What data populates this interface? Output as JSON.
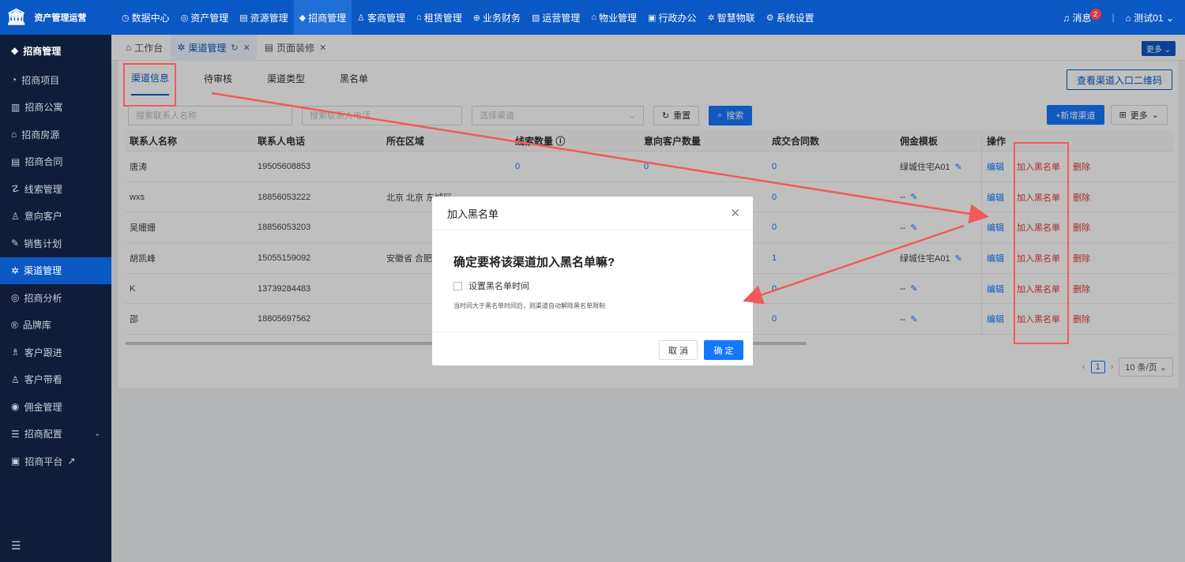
{
  "app": {
    "title": "资产管理运营"
  },
  "topnav": [
    {
      "icon": "dashboard-icon",
      "glyph": "◷",
      "label": "数据中心",
      "active": false
    },
    {
      "icon": "cube-icon",
      "glyph": "◎",
      "label": "资产管理",
      "active": false
    },
    {
      "icon": "resource-icon",
      "glyph": "▤",
      "label": "资源管理",
      "active": false
    },
    {
      "icon": "tag-icon",
      "glyph": "◆",
      "label": "招商管理",
      "active": true
    },
    {
      "icon": "customer-icon",
      "glyph": "♙",
      "label": "客商管理",
      "active": false
    },
    {
      "icon": "building-icon",
      "glyph": "⌂",
      "label": "租赁管理",
      "active": false
    },
    {
      "icon": "finance-icon",
      "glyph": "⊕",
      "label": "业务财务",
      "active": false
    },
    {
      "icon": "operation-icon",
      "glyph": "▧",
      "label": "运营管理",
      "active": false
    },
    {
      "icon": "property-icon",
      "glyph": "⌂",
      "label": "物业管理",
      "active": false
    },
    {
      "icon": "office-icon",
      "glyph": "▣",
      "label": "行政办公",
      "active": false
    },
    {
      "icon": "iot-icon",
      "glyph": "✲",
      "label": "智慧物联",
      "active": false
    },
    {
      "icon": "settings-icon",
      "glyph": "⚙",
      "label": "系统设置",
      "active": false
    }
  ],
  "topright": {
    "message_label": "消息",
    "message_count": "2",
    "user": "测试01"
  },
  "sidebar": {
    "header": "招商管理",
    "items": [
      {
        "label": "招商项目",
        "glyph": "◔",
        "active": false
      },
      {
        "label": "招商公寓",
        "glyph": "▥",
        "active": false
      },
      {
        "label": "招商房源",
        "glyph": "⌂",
        "active": false
      },
      {
        "label": "招商合同",
        "glyph": "▤",
        "active": false
      },
      {
        "label": "线索管理",
        "glyph": "☡",
        "active": false
      },
      {
        "label": "意向客户",
        "glyph": "♙",
        "active": false
      },
      {
        "label": "销售计划",
        "glyph": "✎",
        "active": false
      },
      {
        "label": "渠道管理",
        "glyph": "✲",
        "active": true
      },
      {
        "label": "招商分析",
        "glyph": "◎",
        "active": false
      },
      {
        "label": "品牌库",
        "glyph": "®",
        "active": false
      },
      {
        "label": "客户跟进",
        "glyph": "♗",
        "active": false
      },
      {
        "label": "客户带看",
        "glyph": "♙",
        "active": false
      },
      {
        "label": "佣金管理",
        "glyph": "◉",
        "active": false
      },
      {
        "label": "招商配置",
        "glyph": "☰",
        "active": false,
        "has_arrow": true
      },
      {
        "label": "招商平台",
        "glyph": "▣",
        "active": false,
        "external": true
      }
    ]
  },
  "pagetabs": [
    {
      "label": "工作台",
      "glyph": "⌂",
      "active": false,
      "closable": false
    },
    {
      "label": "渠道管理",
      "glyph": "✲",
      "active": true,
      "closable": true
    },
    {
      "label": "页面装修",
      "glyph": "▤",
      "active": false,
      "closable": true
    }
  ],
  "pagetabs_more": "更多",
  "subtabs": [
    {
      "label": "渠道信息",
      "active": true
    },
    {
      "label": "待审核",
      "active": false
    },
    {
      "label": "渠道类型",
      "active": false
    },
    {
      "label": "黑名单",
      "active": false
    }
  ],
  "qr_button": "查看渠道入口二维码",
  "filters": {
    "name_placeholder": "搜索联系人名称",
    "phone_placeholder": "搜索联系人电话",
    "channel_placeholder": "选择渠道",
    "reset": "重置",
    "search": "搜索",
    "add": "+新增渠道",
    "more": "更多"
  },
  "table": {
    "headers": [
      "联系人名称",
      "联系人电话",
      "所在区域",
      "线索数量",
      "意向客户数量",
      "成交合同数",
      "佣金模板",
      "操作"
    ],
    "rows": [
      {
        "name": "唐涛",
        "phone": "19505608853",
        "region": "",
        "leads": "0",
        "intent": "0",
        "contracts": "0",
        "template": "绿城住宅A01"
      },
      {
        "name": "wxs",
        "phone": "18856053222",
        "region": "北京 北京 东城区",
        "leads": "",
        "intent": "",
        "contracts": "0",
        "template": "--"
      },
      {
        "name": "吴姗姗",
        "phone": "18856053203",
        "region": "",
        "leads": "",
        "intent": "",
        "contracts": "0",
        "template": "--"
      },
      {
        "name": "胡凯峰",
        "phone": "15055159092",
        "region": "安徽省 合肥市",
        "leads": "",
        "intent": "",
        "contracts": "1",
        "template": "绿城住宅A01"
      },
      {
        "name": "K",
        "phone": "13739284483",
        "region": "",
        "leads": "",
        "intent": "",
        "contracts": "0",
        "template": "--"
      },
      {
        "name": "邵",
        "phone": "18805697562",
        "region": "",
        "leads": "",
        "intent": "",
        "contracts": "0",
        "template": "--"
      }
    ],
    "actions": {
      "edit": "编辑",
      "blacklist": "加入黑名单",
      "delete": "删除"
    }
  },
  "pagination": {
    "page": "1",
    "size": "10 条/页"
  },
  "modal": {
    "title": "加入黑名单",
    "question": "确定要将该渠道加入黑名单嘛?",
    "checkbox_label": "设置黑名单时间",
    "note": "当时间大于黑名单时间后，则渠道自动解除黑名单限制",
    "cancel": "取 消",
    "ok": "确 定"
  },
  "colors": {
    "primary": "#0a58c4",
    "accent": "#1677ff",
    "danger": "#e5383b",
    "sidebar": "#0f1d3a",
    "annotation": "#f05a5a"
  }
}
